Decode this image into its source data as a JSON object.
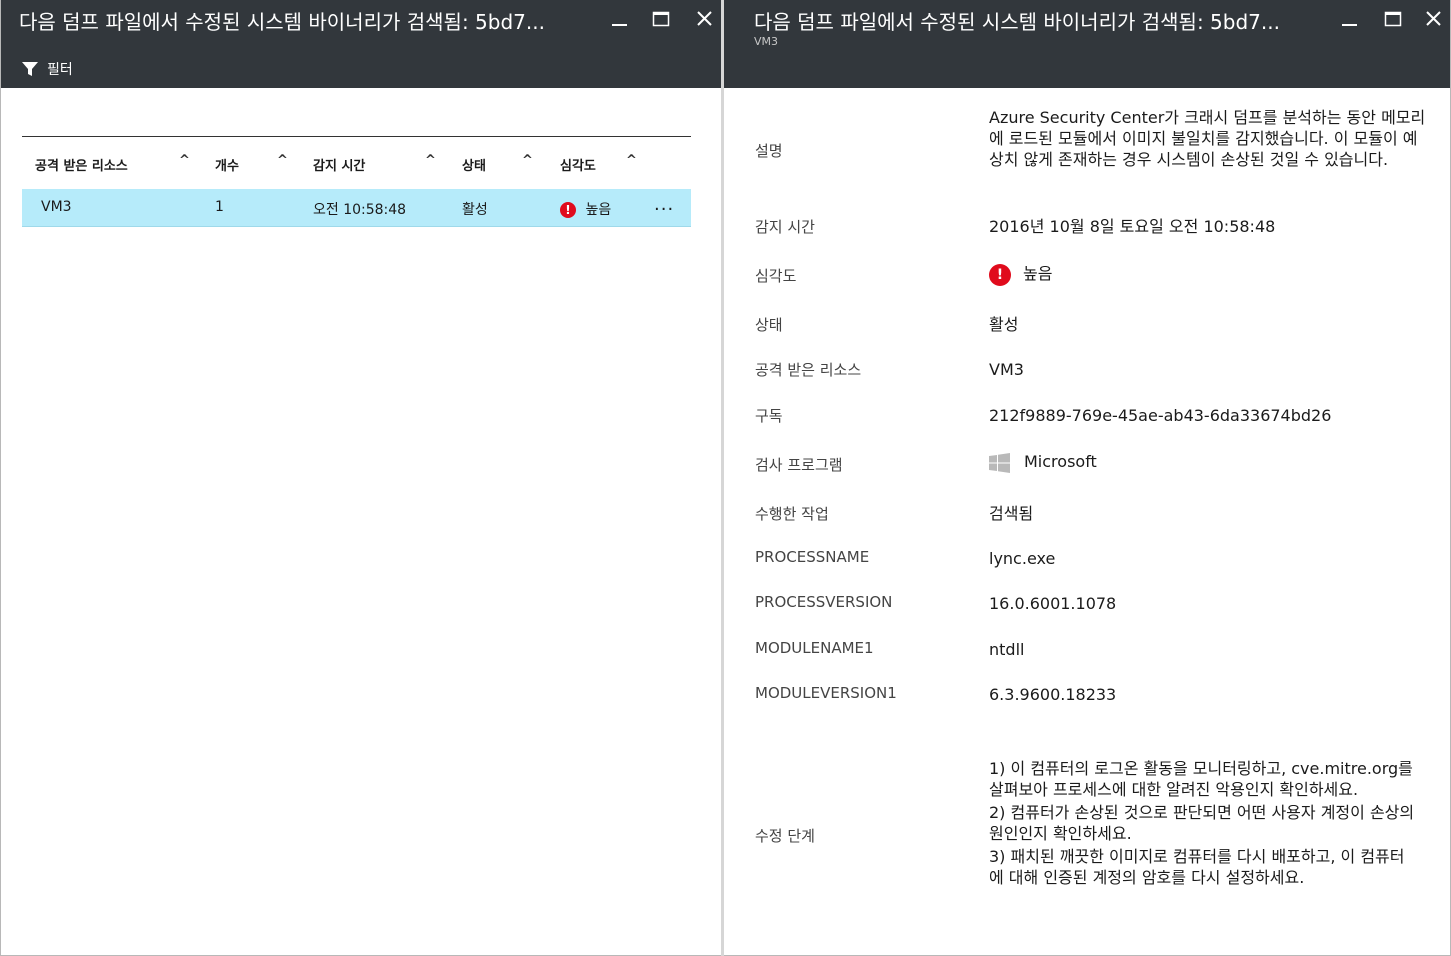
{
  "left": {
    "title": "다음 덤프 파일에서 수정된 시스템 바이너리가 검색됨: 5bd7...",
    "filter_label": "필터",
    "columns": [
      {
        "label": "공격 받은 리소스"
      },
      {
        "label": "개수"
      },
      {
        "label": "감지 시간"
      },
      {
        "label": "상태"
      },
      {
        "label": "심각도"
      }
    ],
    "rows": [
      {
        "resource": "VM3",
        "count": "1",
        "time": "오전 10:58:48",
        "state": "활성",
        "severity": "높음",
        "more": "..."
      }
    ]
  },
  "right": {
    "title": "다음 덤프 파일에서 수정된 시스템 바이너리가 검색됨: 5bd7...",
    "subtitle": "VM3",
    "details": {
      "description_label": "설명",
      "description": "Azure Security Center가 크래시 덤프를 분석하는 동안 메모리에 로드된 모듈에서 이미지 불일치를 감지했습니다. 이 모듈이 예상치 않게 존재하는 경우 시스템이 손상된 것일 수 있습니다.",
      "detected_label": "감지 시간",
      "detected": "2016년 10월 8일 토요일 오전 10:58:48",
      "severity_label": "심각도",
      "severity": "높음",
      "state_label": "상태",
      "state": "활성",
      "resource_label": "공격 받은 리소스",
      "resource": "VM3",
      "subscription_label": "구독",
      "subscription": "212f9889-769e-45ae-ab43-6da33674bd26",
      "reporter_label": "검사 프로그램",
      "reporter": "Microsoft",
      "action_label": "수행한 작업",
      "action": "검색됨",
      "processname_label": "PROCESSNAME",
      "processname": "lync.exe",
      "processversion_label": "PROCESSVERSION",
      "processversion": "16.0.6001.1078",
      "modulename_label": "MODULENAME1",
      "modulename": "ntdll",
      "moduleversion_label": "MODULEVERSION1",
      "moduleversion": "6.3.9600.18233",
      "remediation_label": "수정 단계",
      "remediation_steps": [
        "1) 이 컴퓨터의 로그온 활동을 모니터링하고, cve.mitre.org를 살펴보아 프로세스에 대한 알려진 악용인지 확인하세요.",
        "2) 컴퓨터가 손상된 것으로 판단되면 어떤 사용자 계정이 손상의 원인인지 확인하세요.",
        "3) 패치된 깨끗한 이미지로 컴퓨터를 다시 배포하고, 이 컴퓨터에 대해 인증된 계정의 암호를 다시 설정하세요."
      ]
    }
  },
  "colors": {
    "header_bg": "#32373c",
    "selected_row": "#b6ebfa",
    "severity_high": "#e00b1c"
  },
  "icons": {
    "filter": "filter-icon",
    "minimize": "minimize-icon",
    "maximize": "maximize-icon",
    "close": "close-icon",
    "severity": "error-icon",
    "vendor": "windows-logo-icon"
  }
}
